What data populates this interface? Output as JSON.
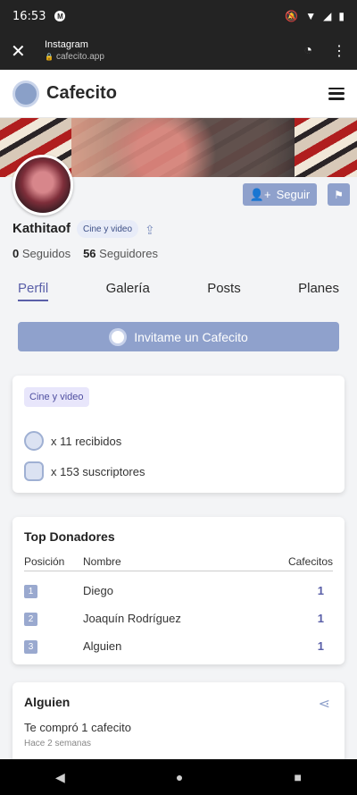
{
  "status": {
    "time": "16:53"
  },
  "browser": {
    "title": "Instagram",
    "url": "cafecito.app"
  },
  "app": {
    "brand": "Cafecito"
  },
  "profile": {
    "username": "Kathitaof",
    "category_badge": "Cine y video",
    "follow_label": "Seguir",
    "following_count": "0",
    "following_label": "Seguidos",
    "followers_count": "56",
    "followers_label": "Seguidores"
  },
  "tabs": [
    "Perfil",
    "Galería",
    "Posts",
    "Planes"
  ],
  "invite_label": "Invitame un Cafecito",
  "about": {
    "tag": "Cine y video",
    "received": "x 11 recibidos",
    "subscribers": "x 153 suscriptores"
  },
  "top_donors": {
    "title": "Top Donadores",
    "headers": {
      "pos": "Posición",
      "name": "Nombre",
      "count": "Cafecitos"
    },
    "rows": [
      {
        "pos": "1",
        "name": "Diego",
        "count": "1"
      },
      {
        "pos": "2",
        "name": "Joaquín Rodríguez",
        "count": "1"
      },
      {
        "pos": "3",
        "name": "Alguien",
        "count": "1"
      }
    ]
  },
  "post": {
    "name": "Alguien",
    "message": "Te compró 1 cafecito",
    "time": "Hace 2 semanas"
  },
  "colors": {
    "accent": "#5a5fa8",
    "button": "#8fa1cc"
  },
  "icons": [
    "close-icon",
    "lock-icon",
    "timer-icon",
    "more-vert-icon",
    "menu-icon",
    "add-user-icon",
    "flag-icon",
    "share-icon",
    "cafecito-logo-icon"
  ]
}
